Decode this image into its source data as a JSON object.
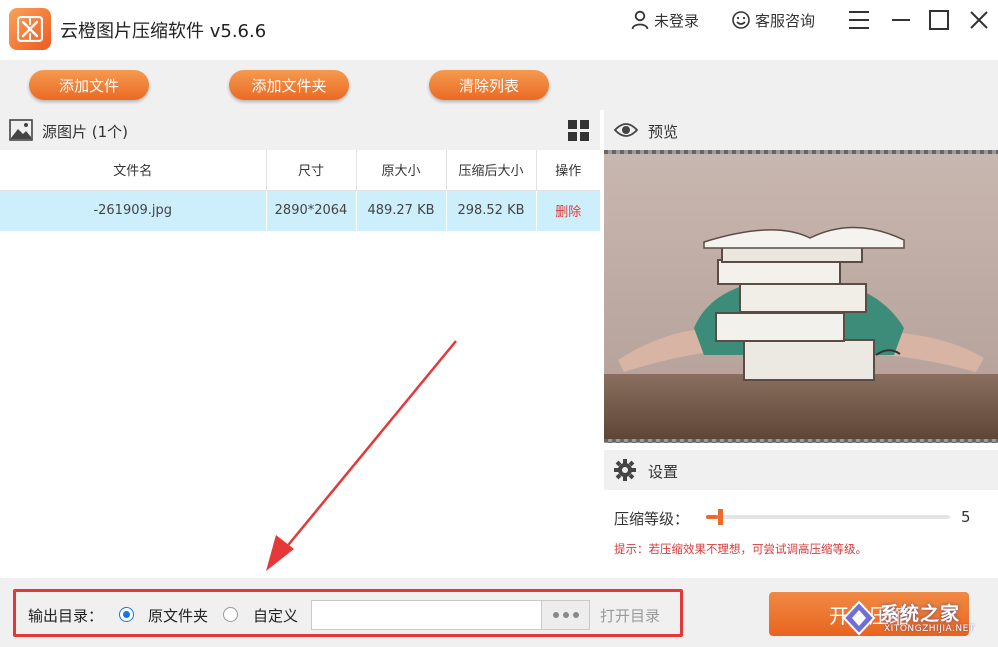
{
  "app": {
    "title": "云橙图片压缩软件 v5.6.6"
  },
  "titlebar": {
    "login": "未登录",
    "service": "客服咨询"
  },
  "toolbar": {
    "add_file": "添加文件",
    "add_folder": "添加文件夹",
    "clear_list": "清除列表"
  },
  "source": {
    "title": "源图片 (1个)",
    "columns": [
      "文件名",
      "尺寸",
      "原大小",
      "压缩后大小",
      "操作"
    ],
    "rows": [
      {
        "name": "-261909.jpg",
        "size": "2890*2064",
        "original": "489.27 KB",
        "compressed": "298.52 KB",
        "action": "删除"
      }
    ]
  },
  "preview": {
    "title": "预览"
  },
  "settings": {
    "title": "设置",
    "level_label": "压缩等级：",
    "level_value": "5",
    "level_fraction": 0.05,
    "hint": "提示：若压缩效果不理想，可尝试调高压缩等级。"
  },
  "output": {
    "label": "输出目录：",
    "option_original": "原文件夹",
    "option_custom": "自定义",
    "selected": "原文件夹",
    "path_value": "",
    "open_dir": "打开目录"
  },
  "start_button": "开始压缩",
  "watermark": {
    "text": "系统之家",
    "sub": "XITONGZHIJIA.NET"
  },
  "colors": {
    "accent": "#ee6a2a",
    "selected_row": "#cdeefb",
    "highlight": "#e53838",
    "radio": "#1a73e8"
  }
}
